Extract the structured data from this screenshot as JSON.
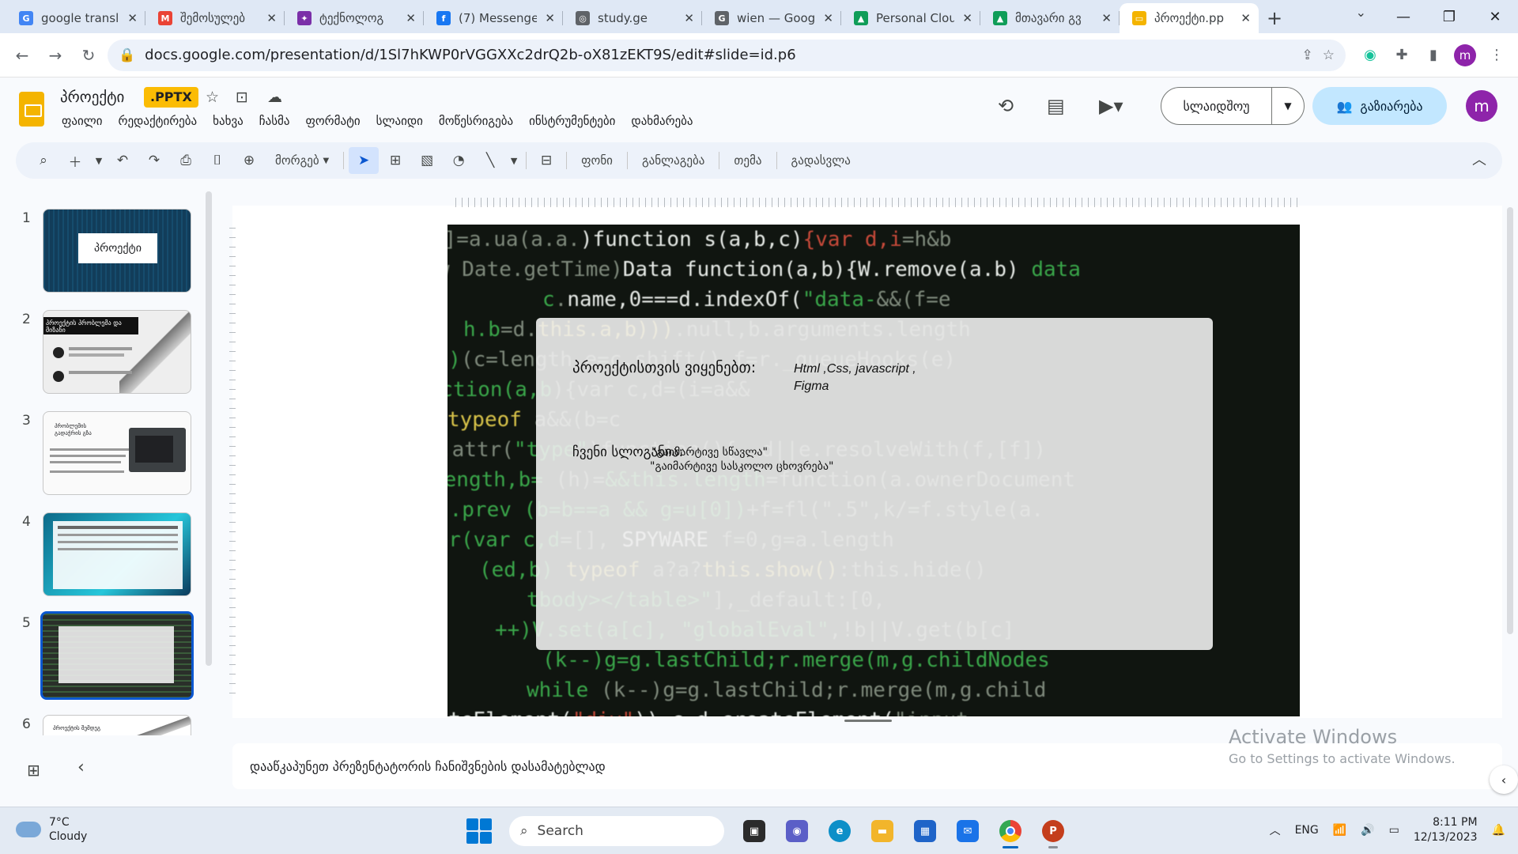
{
  "browser": {
    "tabs": [
      {
        "title": "google transl",
        "icon": "G",
        "color": "#4285f4"
      },
      {
        "title": "შემოსულებ",
        "icon": "M",
        "color": "#ea4335"
      },
      {
        "title": "ტექნოლოგ",
        "icon": "✦",
        "color": "#7b2fa8"
      },
      {
        "title": "(7) Messenge",
        "icon": "f",
        "color": "#1877f2"
      },
      {
        "title": "study.ge",
        "icon": "◎",
        "color": "#5f6368"
      },
      {
        "title": "wien — Goog",
        "icon": "G",
        "color": "#5f6368"
      },
      {
        "title": "Personal Clou",
        "icon": "▲",
        "color": "#0f9d58"
      },
      {
        "title": "მთავარი გვ",
        "icon": "▲",
        "color": "#0f9d58"
      },
      {
        "title": "პროექტი.pp",
        "icon": "▭",
        "color": "#f4b400"
      }
    ],
    "url": "docs.google.com/presentation/d/1Sl7hKWP0rVGGXXc2drQ2b-oX81zEKT9S/edit#slide=id.p6",
    "profile_initial": "m"
  },
  "docs": {
    "title": "პროექტი",
    "badge": ".PPTX",
    "menu": [
      "ფაილი",
      "რედაქტირება",
      "ხახვა",
      "ჩასმა",
      "ფორმატი",
      "სლაიდი",
      "მოწესრიგება",
      "ინსტრუმენტები",
      "დახმარება"
    ],
    "slideshow_label": "სლაიდშოუ",
    "share_label": "გაზიარება",
    "account_initial": "m"
  },
  "toolbar": {
    "zoom_label": "მორგებ",
    "background": "ფონი",
    "layout": "განლაგება",
    "theme": "თემა",
    "transition": "გადასვლა"
  },
  "filmstrip": {
    "numbers": [
      "1",
      "2",
      "3",
      "4",
      "5",
      "6"
    ],
    "thumb1_title": "პროექტი",
    "thumb2_title": "პროექტის პრობლემა და მიზანი",
    "thumb3_title": "პრობლემის გადაჭრის გზა",
    "thumb6_title": "პროექტის შემდეგ"
  },
  "slide": {
    "tools_label": "პროექტისთვის ვიყენებთ:",
    "tools_value": "Html ,Css, javascript , Figma",
    "slogan_label": "ჩვენი სლოგანია:",
    "slogan_line1": "\"გაიმარტივე სწავლა\"",
    "slogan_line2": "\"გაიმარტივე სასკოლო ცხოვრება\""
  },
  "notes": {
    "placeholder": "დააწკაპუნეთ პრეზენტატორის ჩანიშვნების დასამატებლად"
  },
  "watermark": {
    "line1": "Activate Windows",
    "line2": "Go to Settings to activate Windows."
  },
  "taskbar": {
    "temp": "7°C",
    "condition": "Cloudy",
    "search": "Search",
    "lang": "ENG",
    "time": "8:11 PM",
    "date": "12/13/2023"
  }
}
